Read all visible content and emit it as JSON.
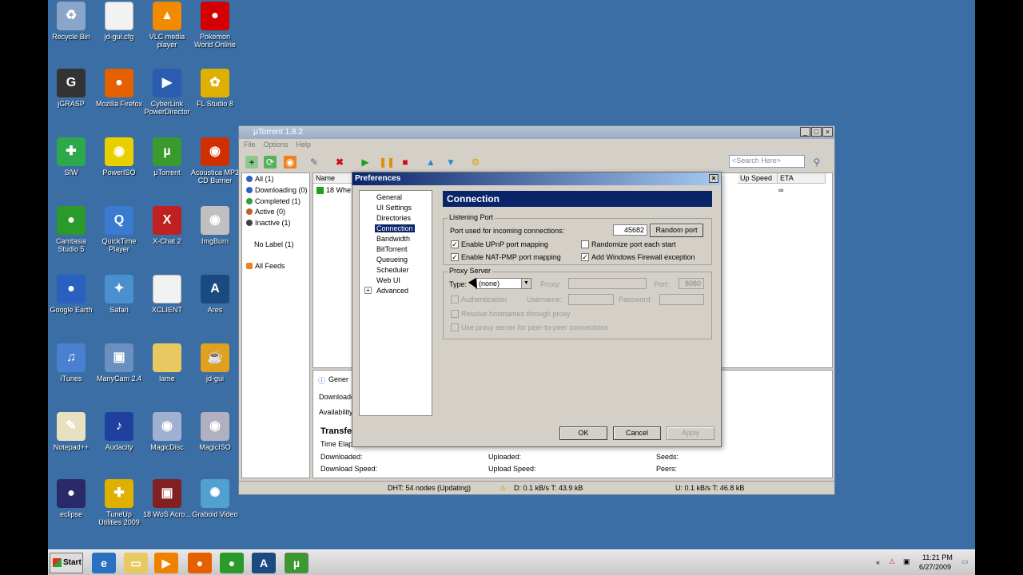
{
  "desktop": {
    "icons": [
      {
        "label": "Recycle Bin",
        "icon": "recycle-bin-icon",
        "color": "#8aa5c8",
        "glyph": "♻"
      },
      {
        "label": "jd-gui.cfg",
        "icon": "file-icon",
        "color": "#f2f2f2",
        "glyph": ""
      },
      {
        "label": "VLC media player",
        "icon": "vlc-icon",
        "color": "#f08a00",
        "glyph": "▲"
      },
      {
        "label": "Pokemon World Online",
        "icon": "pokeball-icon",
        "color": "#d40000",
        "glyph": "●"
      },
      {
        "label": "jGRASP",
        "icon": "jgrasp-icon",
        "color": "#333333",
        "glyph": "G"
      },
      {
        "label": "Mozilla Firefox",
        "icon": "firefox-icon",
        "color": "#e66000",
        "glyph": "●"
      },
      {
        "label": "CyberLink PowerDirector",
        "icon": "powerdirector-icon",
        "color": "#2a5db0",
        "glyph": "▶"
      },
      {
        "label": "FL Studio 8",
        "icon": "flstudio-icon",
        "color": "#e0b000",
        "glyph": "✿"
      },
      {
        "label": "SIW",
        "icon": "siw-icon",
        "color": "#2da84a",
        "glyph": "✚"
      },
      {
        "label": "PowerISO",
        "icon": "poweriso-icon",
        "color": "#e8d000",
        "glyph": "◉"
      },
      {
        "label": "µTorrent",
        "icon": "utorrent-icon",
        "color": "#3a9a2e",
        "glyph": "µ"
      },
      {
        "label": "Acoustica MP3 CD Burner",
        "icon": "acoustica-icon",
        "color": "#d03000",
        "glyph": "◉"
      },
      {
        "label": "Camtasia Studio 5",
        "icon": "camtasia-icon",
        "color": "#2a9a2a",
        "glyph": "●"
      },
      {
        "label": "QuickTime Player",
        "icon": "quicktime-icon",
        "color": "#3a7ad0",
        "glyph": "Q"
      },
      {
        "label": "X-Chat 2",
        "icon": "xchat-icon",
        "color": "#c02020",
        "glyph": "X"
      },
      {
        "label": "ImgBurn",
        "icon": "imgburn-icon",
        "color": "#c0c0c0",
        "glyph": "◉"
      },
      {
        "label": "Google Earth",
        "icon": "google-earth-icon",
        "color": "#2a60c0",
        "glyph": "●"
      },
      {
        "label": "Safari",
        "icon": "safari-icon",
        "color": "#4a90d0",
        "glyph": "✦"
      },
      {
        "label": "XCLIENT",
        "icon": "file-icon",
        "color": "#f2f2f2",
        "glyph": ""
      },
      {
        "label": "Ares",
        "icon": "ares-icon",
        "color": "#1a4a80",
        "glyph": "A"
      },
      {
        "label": "iTunes",
        "icon": "itunes-icon",
        "color": "#4a80d0",
        "glyph": "♫"
      },
      {
        "label": "ManyCam 2.4",
        "icon": "manycam-icon",
        "color": "#6a90c0",
        "glyph": "▣"
      },
      {
        "label": "lame",
        "icon": "folder-icon",
        "color": "#e8c860",
        "glyph": ""
      },
      {
        "label": "jd-gui",
        "icon": "coffee-icon",
        "color": "#e0a020",
        "glyph": "☕"
      },
      {
        "label": "Notepad++",
        "icon": "notepadpp-icon",
        "color": "#e8e0c0",
        "glyph": "✎"
      },
      {
        "label": "Audacity",
        "icon": "audacity-icon",
        "color": "#2040a0",
        "glyph": "♪"
      },
      {
        "label": "MagicDisc",
        "icon": "magicdisc-icon",
        "color": "#a0b0d0",
        "glyph": "◉"
      },
      {
        "label": "MagicISO",
        "icon": "magiciso-icon",
        "color": "#b0b0c0",
        "glyph": "◉"
      },
      {
        "label": "eclipse",
        "icon": "eclipse-icon",
        "color": "#2a2a6a",
        "glyph": "●"
      },
      {
        "label": "TuneUp Utilities 2009",
        "icon": "tuneup-icon",
        "color": "#e0b000",
        "glyph": "✚"
      },
      {
        "label": "18 WoS Acro...",
        "icon": "game-icon",
        "color": "#802020",
        "glyph": "▣"
      },
      {
        "label": "Graboid Video",
        "icon": "graboid-icon",
        "color": "#50a0d0",
        "glyph": "✺"
      }
    ]
  },
  "utorrent": {
    "title": "µTorrent 1.8.2",
    "menu": [
      "File",
      "Options",
      "Help"
    ],
    "search_placeholder": "<Search Here>",
    "sidebar": {
      "items": [
        {
          "label": "All (1)",
          "color": "#3060c0"
        },
        {
          "label": "Downloading (0)",
          "color": "#3060c0"
        },
        {
          "label": "Completed (1)",
          "color": "#30a030"
        },
        {
          "label": "Active (0)",
          "color": "#c06020"
        },
        {
          "label": "Inactive (1)",
          "color": "#404040"
        }
      ],
      "no_label": "No Label (1)",
      "feeds": "All Feeds"
    },
    "list": {
      "col_name": "Name",
      "col_upspeed": "Up Speed",
      "col_eta": "ETA",
      "row_name": "18 Whe",
      "row_eta": "∞"
    },
    "detail": {
      "tab_general": "Gener",
      "downloaded_lbl": "Downloade",
      "availability_lbl": "Availability",
      "transfer_title": "Transfe",
      "time_elapsed": "Time Elaps",
      "downloaded": "Downloaded:",
      "download_speed": "Download Speed:",
      "uploaded": "Uploaded:",
      "upload_speed": "Upload Speed:",
      "seeds": "Seeds:",
      "peers": "Peers:"
    },
    "status": {
      "dht": "DHT: 54 nodes (Updating)",
      "down": "D: 0.1 kB/s T: 43.9 kB",
      "up": "U: 0.1 kB/s T: 46.8 kB"
    }
  },
  "prefs": {
    "title": "Preferences",
    "tree": [
      "General",
      "UI Settings",
      "Directories",
      "Connection",
      "Bandwidth",
      "BitTorrent",
      "Queueing",
      "Scheduler",
      "Web UI",
      "Advanced"
    ],
    "header": "Connection",
    "listening": {
      "title": "Listening Port",
      "port_label": "Port used for incoming connections:",
      "port_value": "45682",
      "random_btn": "Random port",
      "upnp": "Enable UPnP port mapping",
      "natpmp": "Enable NAT-PMP port mapping",
      "randomize": "Randomize port each start",
      "firewall": "Add Windows Firewall exception"
    },
    "proxy": {
      "title": "Proxy Server",
      "type_label": "Type:",
      "type_value": "(none)",
      "proxy_label": "Proxy:",
      "port_label": "Port:",
      "port_value": "8080",
      "auth": "Authentication",
      "username": "Username:",
      "password": "Password:",
      "resolve": "Resolve hostnames through proxy",
      "p2p": "Use proxy server for peer-to-peer connections"
    },
    "buttons": {
      "ok": "OK",
      "cancel": "Cancel",
      "apply": "Apply"
    }
  },
  "taskbar": {
    "start": "Start",
    "time": "11:21 PM",
    "date": "6/27/2009"
  }
}
